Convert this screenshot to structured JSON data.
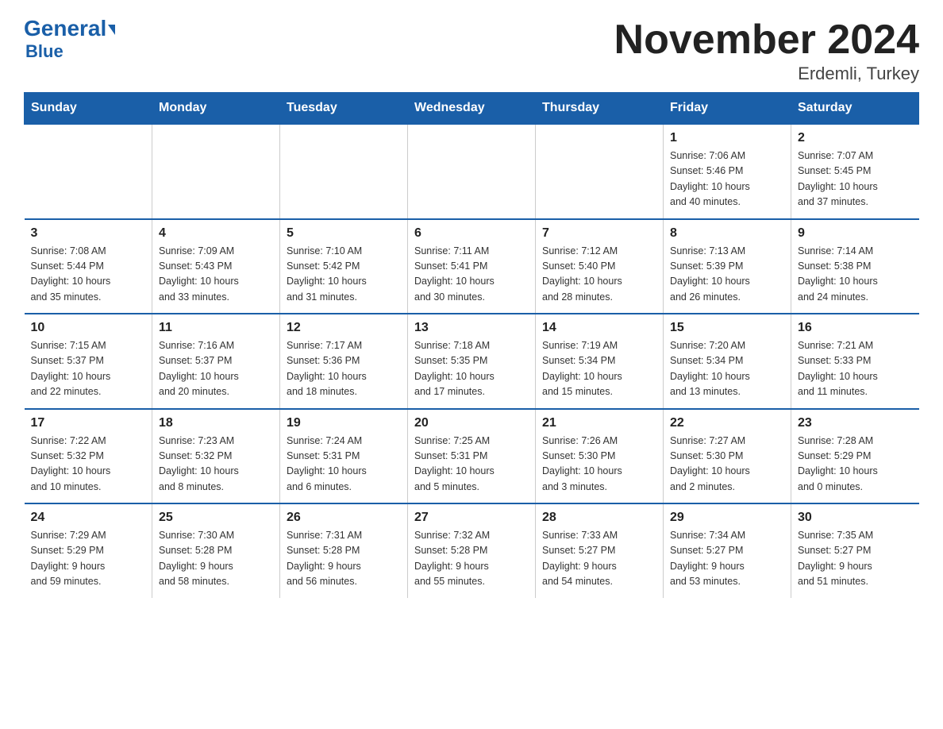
{
  "logo": {
    "general": "General",
    "blue": "Blue"
  },
  "title": "November 2024",
  "subtitle": "Erdemli, Turkey",
  "days_of_week": [
    "Sunday",
    "Monday",
    "Tuesday",
    "Wednesday",
    "Thursday",
    "Friday",
    "Saturday"
  ],
  "weeks": [
    [
      {
        "num": "",
        "info": ""
      },
      {
        "num": "",
        "info": ""
      },
      {
        "num": "",
        "info": ""
      },
      {
        "num": "",
        "info": ""
      },
      {
        "num": "",
        "info": ""
      },
      {
        "num": "1",
        "info": "Sunrise: 7:06 AM\nSunset: 5:46 PM\nDaylight: 10 hours\nand 40 minutes."
      },
      {
        "num": "2",
        "info": "Sunrise: 7:07 AM\nSunset: 5:45 PM\nDaylight: 10 hours\nand 37 minutes."
      }
    ],
    [
      {
        "num": "3",
        "info": "Sunrise: 7:08 AM\nSunset: 5:44 PM\nDaylight: 10 hours\nand 35 minutes."
      },
      {
        "num": "4",
        "info": "Sunrise: 7:09 AM\nSunset: 5:43 PM\nDaylight: 10 hours\nand 33 minutes."
      },
      {
        "num": "5",
        "info": "Sunrise: 7:10 AM\nSunset: 5:42 PM\nDaylight: 10 hours\nand 31 minutes."
      },
      {
        "num": "6",
        "info": "Sunrise: 7:11 AM\nSunset: 5:41 PM\nDaylight: 10 hours\nand 30 minutes."
      },
      {
        "num": "7",
        "info": "Sunrise: 7:12 AM\nSunset: 5:40 PM\nDaylight: 10 hours\nand 28 minutes."
      },
      {
        "num": "8",
        "info": "Sunrise: 7:13 AM\nSunset: 5:39 PM\nDaylight: 10 hours\nand 26 minutes."
      },
      {
        "num": "9",
        "info": "Sunrise: 7:14 AM\nSunset: 5:38 PM\nDaylight: 10 hours\nand 24 minutes."
      }
    ],
    [
      {
        "num": "10",
        "info": "Sunrise: 7:15 AM\nSunset: 5:37 PM\nDaylight: 10 hours\nand 22 minutes."
      },
      {
        "num": "11",
        "info": "Sunrise: 7:16 AM\nSunset: 5:37 PM\nDaylight: 10 hours\nand 20 minutes."
      },
      {
        "num": "12",
        "info": "Sunrise: 7:17 AM\nSunset: 5:36 PM\nDaylight: 10 hours\nand 18 minutes."
      },
      {
        "num": "13",
        "info": "Sunrise: 7:18 AM\nSunset: 5:35 PM\nDaylight: 10 hours\nand 17 minutes."
      },
      {
        "num": "14",
        "info": "Sunrise: 7:19 AM\nSunset: 5:34 PM\nDaylight: 10 hours\nand 15 minutes."
      },
      {
        "num": "15",
        "info": "Sunrise: 7:20 AM\nSunset: 5:34 PM\nDaylight: 10 hours\nand 13 minutes."
      },
      {
        "num": "16",
        "info": "Sunrise: 7:21 AM\nSunset: 5:33 PM\nDaylight: 10 hours\nand 11 minutes."
      }
    ],
    [
      {
        "num": "17",
        "info": "Sunrise: 7:22 AM\nSunset: 5:32 PM\nDaylight: 10 hours\nand 10 minutes."
      },
      {
        "num": "18",
        "info": "Sunrise: 7:23 AM\nSunset: 5:32 PM\nDaylight: 10 hours\nand 8 minutes."
      },
      {
        "num": "19",
        "info": "Sunrise: 7:24 AM\nSunset: 5:31 PM\nDaylight: 10 hours\nand 6 minutes."
      },
      {
        "num": "20",
        "info": "Sunrise: 7:25 AM\nSunset: 5:31 PM\nDaylight: 10 hours\nand 5 minutes."
      },
      {
        "num": "21",
        "info": "Sunrise: 7:26 AM\nSunset: 5:30 PM\nDaylight: 10 hours\nand 3 minutes."
      },
      {
        "num": "22",
        "info": "Sunrise: 7:27 AM\nSunset: 5:30 PM\nDaylight: 10 hours\nand 2 minutes."
      },
      {
        "num": "23",
        "info": "Sunrise: 7:28 AM\nSunset: 5:29 PM\nDaylight: 10 hours\nand 0 minutes."
      }
    ],
    [
      {
        "num": "24",
        "info": "Sunrise: 7:29 AM\nSunset: 5:29 PM\nDaylight: 9 hours\nand 59 minutes."
      },
      {
        "num": "25",
        "info": "Sunrise: 7:30 AM\nSunset: 5:28 PM\nDaylight: 9 hours\nand 58 minutes."
      },
      {
        "num": "26",
        "info": "Sunrise: 7:31 AM\nSunset: 5:28 PM\nDaylight: 9 hours\nand 56 minutes."
      },
      {
        "num": "27",
        "info": "Sunrise: 7:32 AM\nSunset: 5:28 PM\nDaylight: 9 hours\nand 55 minutes."
      },
      {
        "num": "28",
        "info": "Sunrise: 7:33 AM\nSunset: 5:27 PM\nDaylight: 9 hours\nand 54 minutes."
      },
      {
        "num": "29",
        "info": "Sunrise: 7:34 AM\nSunset: 5:27 PM\nDaylight: 9 hours\nand 53 minutes."
      },
      {
        "num": "30",
        "info": "Sunrise: 7:35 AM\nSunset: 5:27 PM\nDaylight: 9 hours\nand 51 minutes."
      }
    ]
  ]
}
